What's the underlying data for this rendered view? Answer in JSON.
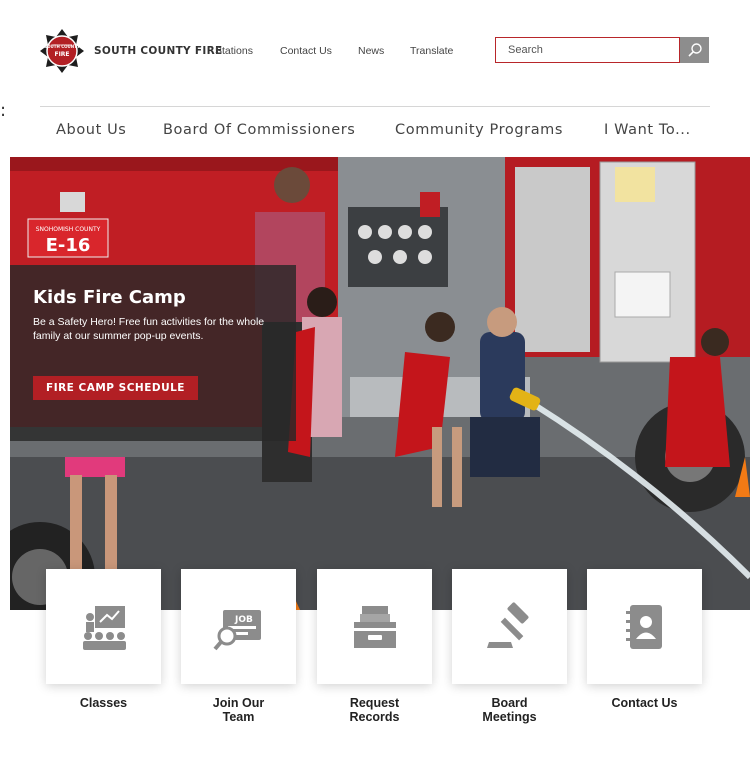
{
  "brand": {
    "name": "SOUTH COUNTY FIRE",
    "badge_text_top": "SOUTH COUNTY",
    "badge_text_bottom": "FIRE",
    "accent_color": "#b21f24"
  },
  "utility_nav": {
    "items": [
      "Stations",
      "Contact Us",
      "News",
      "Translate"
    ]
  },
  "search": {
    "placeholder": "Search",
    "icon": "search-icon"
  },
  "main_nav": {
    "items": [
      "About Us",
      "Board Of Commissioners",
      "Community Programs",
      "I Want To..."
    ]
  },
  "hero": {
    "engine_plate_small": "SNOHOMISH COUNTY",
    "engine_plate_large": "E-16",
    "promo": {
      "title": "Kids Fire Camp",
      "body": "Be a Safety Hero! Free fun activities for the whole family at our summer pop-up events.",
      "button_label": "FIRE CAMP SCHEDULE"
    }
  },
  "quick_links": [
    {
      "label": "Classes",
      "icon": "classroom-icon"
    },
    {
      "label": "Join Our Team",
      "icon": "job-search-icon"
    },
    {
      "label": "Request Records",
      "icon": "file-tray-icon"
    },
    {
      "label": "Board Meetings",
      "icon": "gavel-icon"
    },
    {
      "label": "Contact Us",
      "icon": "address-book-icon"
    }
  ]
}
